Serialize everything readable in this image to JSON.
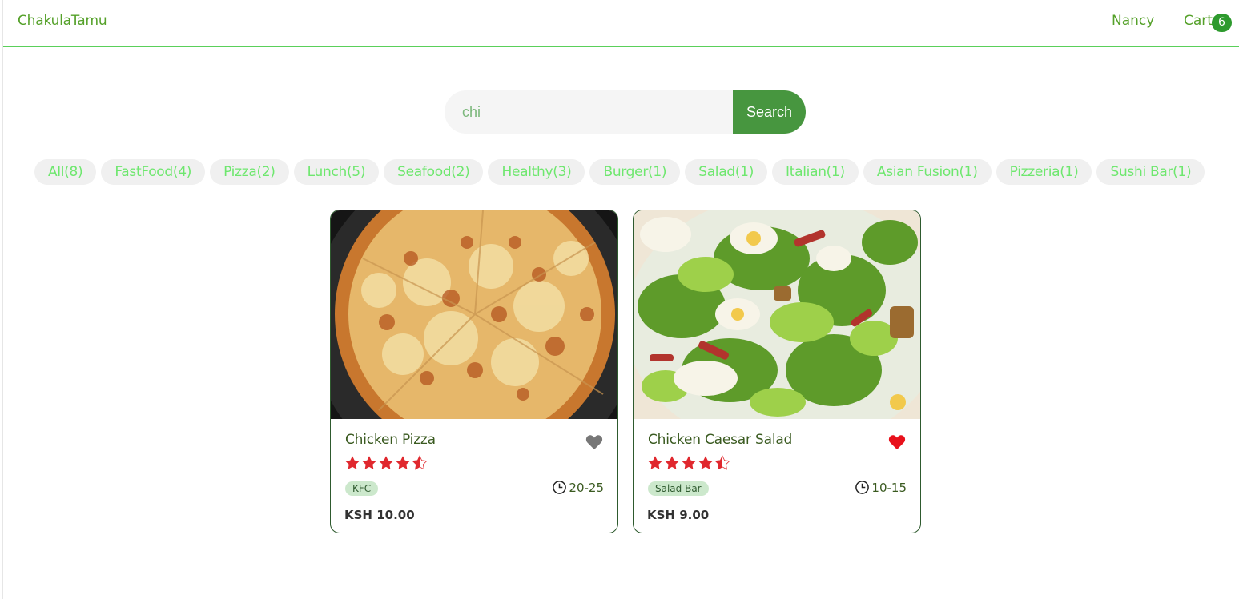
{
  "header": {
    "brand": "ChakulaTamu",
    "user": "Nancy",
    "cart_label": "Cart",
    "cart_count": "6"
  },
  "search": {
    "value": "chi",
    "button_label": "Search"
  },
  "categories": [
    "All(8)",
    "FastFood(4)",
    "Pizza(2)",
    "Lunch(5)",
    "Seafood(2)",
    "Healthy(3)",
    "Burger(1)",
    "Salad(1)",
    "Italian(1)",
    "Asian Fusion(1)",
    "Pizzeria(1)",
    "Sushi Bar(1)"
  ],
  "items": [
    {
      "name": "Chicken Pizza",
      "rating": 4.5,
      "restaurant": "KFC",
      "time": "20-25",
      "price": "KSH 10.00",
      "favorite": false,
      "image_icon": "pizza-image"
    },
    {
      "name": "Chicken Caesar Salad",
      "rating": 4.5,
      "restaurant": "Salad Bar",
      "time": "10-15",
      "price": "KSH 9.00",
      "favorite": true,
      "image_icon": "salad-image"
    }
  ],
  "colors": {
    "brand": "#55a12a",
    "accent": "#47963f",
    "star": "#e0282e",
    "heart_on": "#e8111b",
    "heart_off": "#777777"
  }
}
